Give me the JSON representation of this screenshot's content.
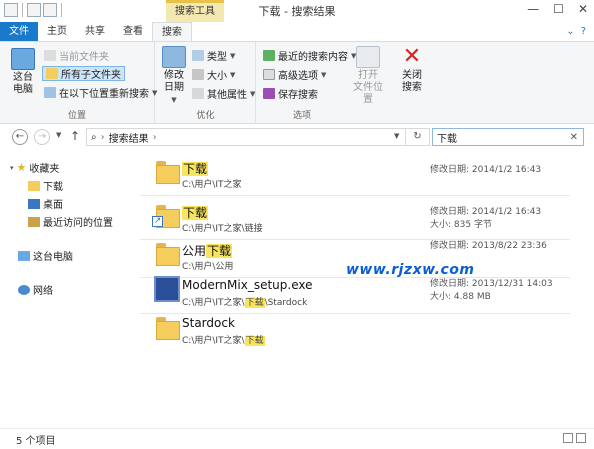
{
  "window": {
    "title": "下载 - 搜索结果",
    "context_tab_group": "搜索工具"
  },
  "tabs": [
    {
      "label": "文件"
    },
    {
      "label": "主页"
    },
    {
      "label": "共享"
    },
    {
      "label": "查看"
    },
    {
      "label": "搜索"
    }
  ],
  "ribbon": {
    "location": {
      "label": "位置",
      "this_pc": "这台\n电脑",
      "current_folder": "当前文件夹",
      "all_subfolders": "所有子文件夹",
      "search_again": "在以下位置重新搜索"
    },
    "refine": {
      "label": "优化",
      "date_modified": "修改\n日期",
      "kind": "类型",
      "size": "大小",
      "other_props": "其他属性"
    },
    "options": {
      "label": "选项",
      "recent_searches": "最近的搜索内容",
      "advanced": "高级选项",
      "save_search": "保存搜索",
      "open_location": "打开\n文件位置",
      "close_search": "关闭\n搜索"
    }
  },
  "address": {
    "path": "搜索结果",
    "search_value": "下载"
  },
  "nav": {
    "favorites": "收藏夹",
    "downloads": "下载",
    "desktop": "桌面",
    "recent": "最近访问的位置",
    "this_pc": "这台电脑",
    "network": "网络"
  },
  "results": [
    {
      "name": "下载",
      "name_pre": "",
      "name_hl": "下载",
      "name_post": "",
      "path": "C:\\用户\\IT之家",
      "path_pre": "C:\\用户\\IT之家",
      "path_hl": "",
      "path_post": "",
      "date_label": "修改日期:",
      "date": "2014/1/2 16:43",
      "size_label": "",
      "size": "",
      "icon": "folder-icon"
    },
    {
      "name": "下载",
      "name_pre": "",
      "name_hl": "下载",
      "name_post": "",
      "path_pre": "C:\\用户\\IT之家\\链接",
      "path_hl": "",
      "path_post": "",
      "date_label": "修改日期:",
      "date": "2014/1/2 16:43",
      "size_label": "大小:",
      "size": "835 字节",
      "icon": "shortcut-icon"
    },
    {
      "name_pre": "公用",
      "name_hl": "下载",
      "name_post": "",
      "path_pre": "C:\\用户\\公用",
      "path_hl": "",
      "path_post": "",
      "date_label": "修改日期:",
      "date": "2013/8/22 23:36",
      "size_label": "",
      "size": "",
      "icon": "folder-icon"
    },
    {
      "name_pre": "ModernMix_setup.exe",
      "name_hl": "",
      "name_post": "",
      "path_pre": "C:\\用户\\IT之家\\",
      "path_hl": "下载",
      "path_post": "\\Stardock",
      "date_label": "修改日期:",
      "date": "2013/12/31 14:03",
      "size_label": "大小:",
      "size": "4.88 MB",
      "icon": "exe-icon"
    },
    {
      "name_pre": "Stardock",
      "name_hl": "",
      "name_post": "",
      "path_pre": "C:\\用户\\IT之家\\",
      "path_hl": "下载",
      "path_post": "",
      "date_label": "",
      "date": "",
      "size_label": "",
      "size": "",
      "icon": "folder-icon"
    }
  ],
  "watermark": "www.rjzxw.com",
  "status": {
    "item_count": "5 个项目"
  },
  "colors": {
    "file_tab": "#1979ca",
    "highlight": "#f9e45e",
    "context_tab": "#f3e8b0",
    "watermark": "#0b5fd4"
  }
}
